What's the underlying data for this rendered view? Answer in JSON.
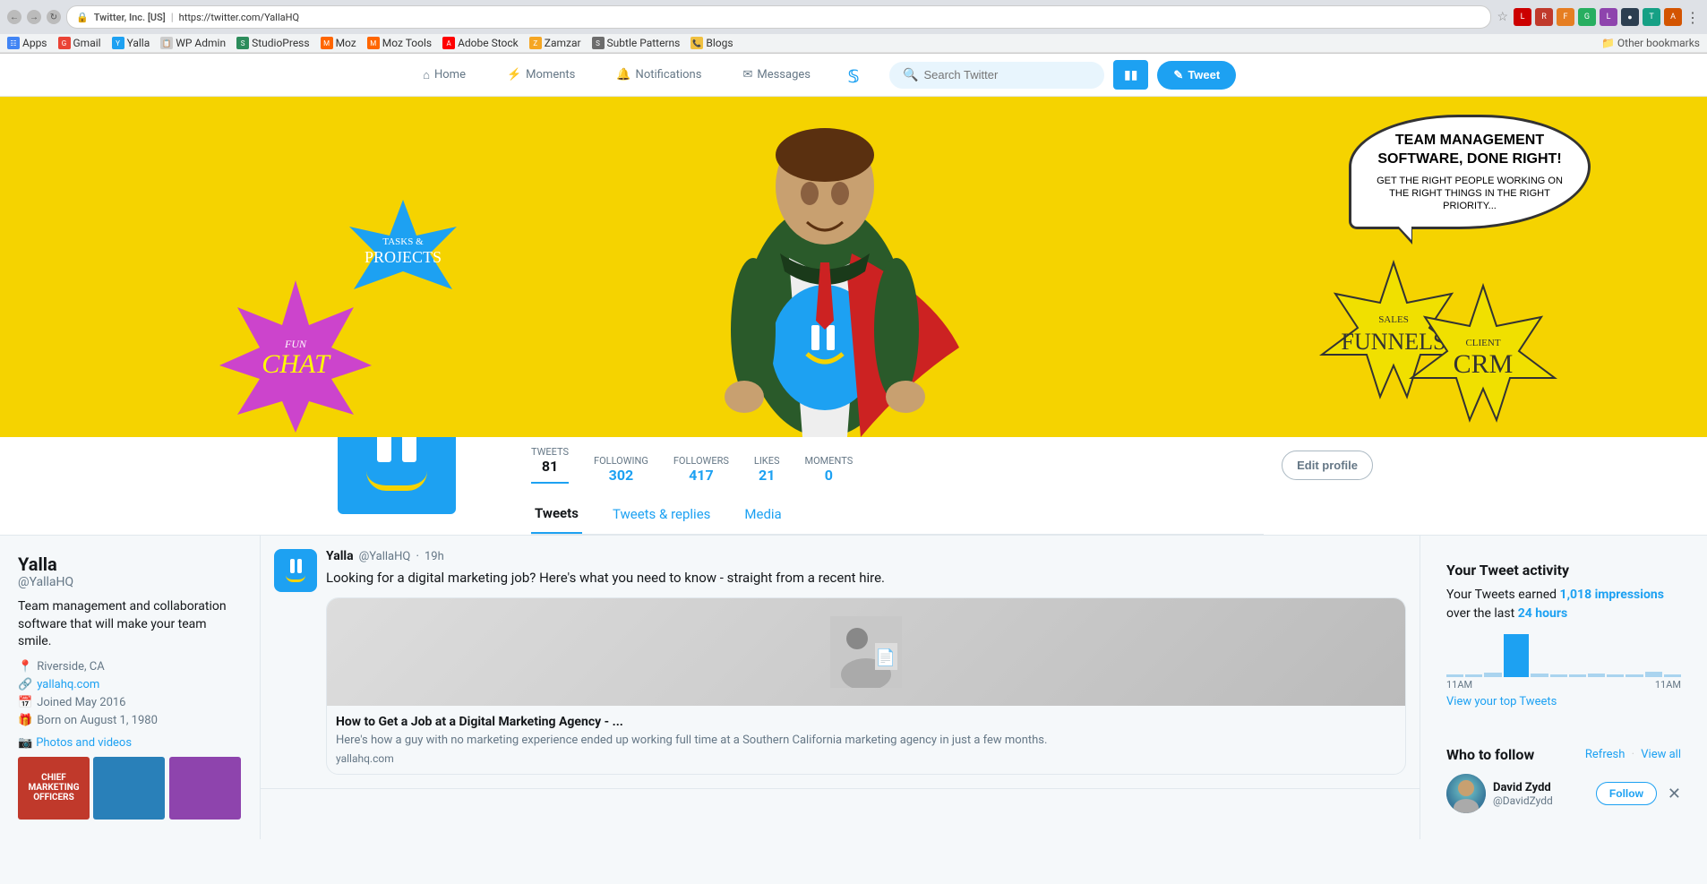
{
  "browser": {
    "back_label": "←",
    "forward_label": "→",
    "refresh_label": "↻",
    "site_name": "Twitter, Inc. [US]",
    "url": "https://twitter.com/YallaHQ",
    "bookmarks": [
      {
        "label": "Apps",
        "type": "apps"
      },
      {
        "label": "Gmail",
        "type": "gmail"
      },
      {
        "label": "Yalla",
        "type": "yalla"
      },
      {
        "label": "WP Admin",
        "type": "wp"
      },
      {
        "label": "StudioPress",
        "type": "sp"
      },
      {
        "label": "Moz",
        "type": "moz"
      },
      {
        "label": "Moz Tools",
        "type": "mozt"
      },
      {
        "label": "Adobe Stock",
        "type": "adobe"
      },
      {
        "label": "Zamzar",
        "type": "zamzar"
      },
      {
        "label": "Subtle Patterns",
        "type": "subtle"
      },
      {
        "label": "Blogs",
        "type": "blogs"
      }
    ],
    "other_bookmarks": "Other bookmarks"
  },
  "nav": {
    "home_label": "Home",
    "moments_label": "Moments",
    "notifications_label": "Notifications",
    "messages_label": "Messages",
    "search_placeholder": "Search Twitter",
    "tweet_button_label": "Tweet"
  },
  "cover": {
    "speech_bubble_line1": "TEAM MANAGEMENT",
    "speech_bubble_line2": "SOFTWARE, DONE RIGHT!",
    "speech_bubble_sub": "GET THE RIGHT PEOPLE WORKING ON THE RIGHT THINGS IN THE RIGHT PRIORITY...",
    "projects_label": "PROJECTS",
    "projects_sub": "TASKS &",
    "chat_label": "CHAT",
    "chat_sub": "FUN",
    "funnels_label": "FUNNELS",
    "funnels_sub": "SALES",
    "crm_label": "CRM",
    "crm_sub": "CLIENT"
  },
  "profile": {
    "name": "Yalla",
    "handle": "@YallaHQ",
    "bio": "Team management and collaboration software that will make your team smile.",
    "location": "Riverside, CA",
    "website": "yallahq.com",
    "joined": "Joined May 2016",
    "birthday": "Born on August 1, 1980",
    "photos_label": "Photos and videos",
    "edit_profile_label": "Edit profile"
  },
  "stats": {
    "tweets_label": "TWEETS",
    "tweets_value": "81",
    "following_label": "FOLLOWING",
    "following_value": "302",
    "followers_label": "FOLLOWERS",
    "followers_value": "417",
    "likes_label": "LIKES",
    "likes_value": "21",
    "moments_label": "MOMENTS",
    "moments_value": "0"
  },
  "tabs": {
    "tweets_label": "Tweets",
    "tweets_replies_label": "Tweets & replies",
    "media_label": "Media"
  },
  "tweet": {
    "author_name": "Yalla",
    "author_handle": "@YallaHQ",
    "time": "19h",
    "text": "Looking for a digital marketing job? Here's what you need to know - straight from a recent hire.",
    "link_title": "How to Get a Job at a Digital Marketing Agency - ...",
    "link_desc": "Here's how a guy with no marketing experience ended up working full time at a Southern California marketing agency in just a few months.",
    "link_domain": "yallahq.com"
  },
  "right_sidebar": {
    "activity_title": "Your Tweet activity",
    "activity_text": "Your Tweets earned",
    "activity_impressions": "1,018 impressions",
    "activity_period": "over the last",
    "activity_hours": "24 hours",
    "chart_label_left": "11AM",
    "chart_label_right": "11AM",
    "view_top_tweets": "View your top Tweets",
    "who_to_follow_title": "Who to follow",
    "refresh_label": "Refresh",
    "view_all_label": "View all",
    "follow_user_name": "David Zydd",
    "follow_user_handle": "@DavidZydd"
  }
}
